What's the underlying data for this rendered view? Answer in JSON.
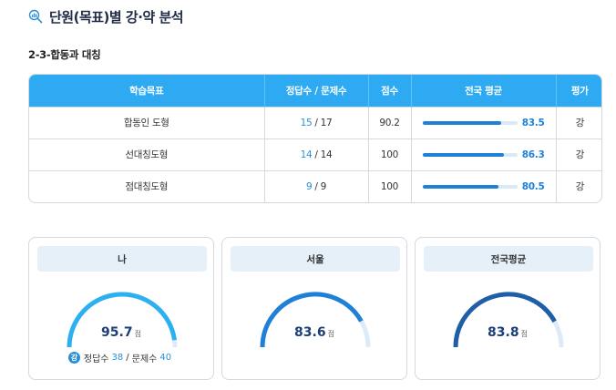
{
  "header": {
    "title": "단원(목표)별 강·약 분석",
    "icon": "search-chart-icon"
  },
  "section": {
    "title": "2-3-합동과 대칭"
  },
  "table": {
    "columns": [
      "학습목표",
      "정답수 / 문제수",
      "점수",
      "전국 평균",
      "평가"
    ],
    "rows": [
      {
        "goal": "합동인 도형",
        "correct": "15",
        "total": "17",
        "score": "90.2",
        "national_avg": 83.5,
        "national_avg_label": "83.5",
        "grade": "강"
      },
      {
        "goal": "선대칭도형",
        "correct": "14",
        "total": "14",
        "score": "100",
        "national_avg": 86.3,
        "national_avg_label": "86.3",
        "grade": "강"
      },
      {
        "goal": "점대칭도형",
        "correct": "9",
        "total": "9",
        "score": "100",
        "national_avg": 80.5,
        "national_avg_label": "80.5",
        "grade": "강"
      }
    ]
  },
  "cards": [
    {
      "label": "나",
      "score": "95.7",
      "score_value": 95.7,
      "unit": "점",
      "color": "#2cb0f0",
      "track": "#dcebf7",
      "detail": {
        "badge": "강",
        "correct_label": "정답수",
        "correct": "38",
        "sep": "/",
        "total_label": "문제수",
        "total": "40"
      }
    },
    {
      "label": "서울",
      "score": "83.6",
      "score_value": 83.6,
      "unit": "점",
      "color": "#1f80d8",
      "track": "#dcebf7"
    },
    {
      "label": "전국평균",
      "score": "83.8",
      "score_value": 83.8,
      "unit": "점",
      "color": "#1f5fa8",
      "track": "#dcebf7"
    }
  ]
}
